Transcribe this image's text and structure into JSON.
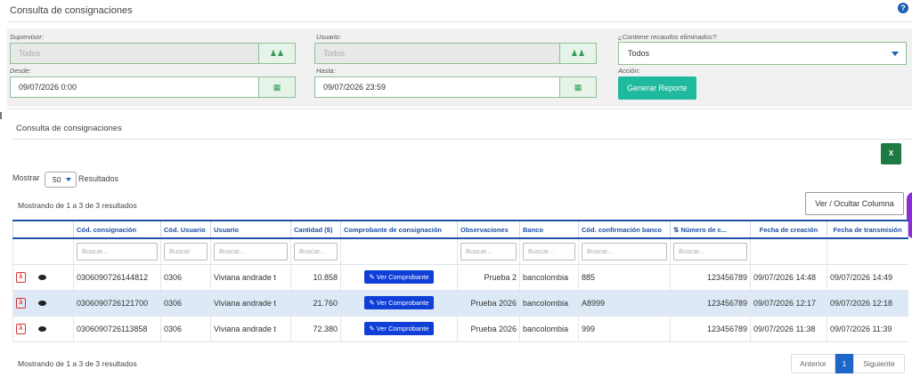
{
  "page": {
    "title": "Consulta de consignaciones",
    "help_icon": "question-circle-icon"
  },
  "filters": {
    "supervisor": {
      "label": "Supervisor:",
      "value": "Todos",
      "addon_icon": "users-icon"
    },
    "usuario": {
      "label": "Usuario:",
      "value": "Todos",
      "addon_icon": "users-icon"
    },
    "recaudos": {
      "label": "¿Contiene recaudos eliminados?:",
      "value": "Todos"
    },
    "desde": {
      "label": "Desde:",
      "value": "09/07/2026 0:00",
      "addon_icon": "calendar-icon"
    },
    "hasta": {
      "label": "Hasta:",
      "value": "09/07/2026 23:59",
      "addon_icon": "calendar-icon"
    },
    "accion": {
      "label": "Acción:",
      "button": "Generar Reporte"
    }
  },
  "results": {
    "title": "Consulta de consignaciones",
    "export_icon": "excel-icon",
    "show_label": "Mostrar",
    "page_length": "50",
    "results_label": "Resultados",
    "info_top": "Mostrando de 1 a 3 de 3 resultados",
    "info_bottom": "Mostrando de 1 a 3 de 3 resultados",
    "colvis_button": "Ver / Ocultar Columna",
    "search_placeholder": "Buscar...",
    "search_placeholder_short": "Buscar",
    "columns": [
      "",
      "Cód. consignación",
      "Cód. Usuario",
      "Usuario",
      "Cantidad ($)",
      "Comprobante de consignación",
      "Observaciones",
      "Banco",
      "Cód. confirmación banco",
      "Número de c...",
      "Fecha de creación",
      "Fecha de transmisión"
    ],
    "view_button": "Ver Comprobante",
    "rows": [
      {
        "codigo": "030609072614481 2",
        "cod_usuario": "0306",
        "usuario": "Viviana andrade t",
        "cantidad": "10.858",
        "observaciones": "Prueba 2",
        "banco": "bancolombia",
        "confirmacion": "885",
        "numero": "123456789",
        "creacion": "09/07/2026 14:48",
        "transmision": "09/07/2026 14:49"
      },
      {
        "codigo": "0306090726121700",
        "cod_usuario": "0306",
        "usuario": "Viviana andrade t",
        "cantidad": "21.760",
        "observaciones": "Prueba 2026",
        "banco": "bancolombia",
        "confirmacion": "A8999",
        "numero": "123456789",
        "creacion": "09/07/2026 12:17",
        "transmision": "09/07/2026 12:18"
      },
      {
        "codigo": "0306090726113858",
        "cod_usuario": "0306",
        "usuario": "Viviana andrade t",
        "cantidad": "72.380",
        "observaciones": "Prueba 2026",
        "banco": "bancolombia",
        "confirmacion": "999",
        "numero": "123456789",
        "creacion": "09/07/2026 11:38",
        "transmision": "09/07/2026 11:39"
      }
    ],
    "pagination": {
      "prev": "Anterior",
      "current": "1",
      "next": "Siguiente"
    }
  }
}
